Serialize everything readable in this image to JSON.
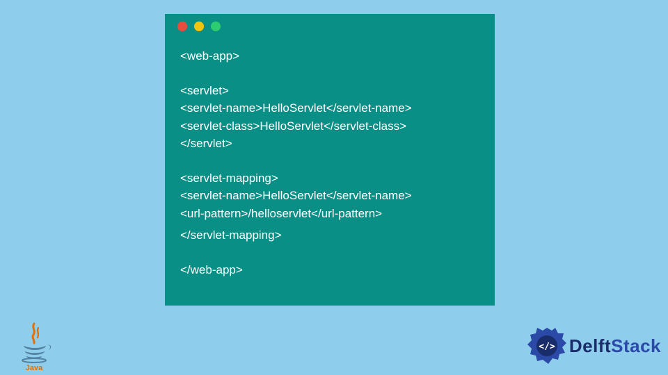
{
  "code": {
    "lines": [
      "<web-app>",
      "",
      "<servlet>",
      "<servlet-name>HelloServlet</servlet-name>",
      "<servlet-class>HelloServlet</servlet-class>",
      "</servlet>",
      "",
      "<servlet-mapping>",
      "<servlet-name>HelloServlet</servlet-name>",
      "<url-pattern>/helloservlet</url-pattern>",
      "</servlet-mapping>",
      "",
      "</web-app>"
    ]
  },
  "brand": {
    "name_part1": "Delft",
    "name_part2": "Stack"
  },
  "logos": {
    "java_label": "Java"
  }
}
